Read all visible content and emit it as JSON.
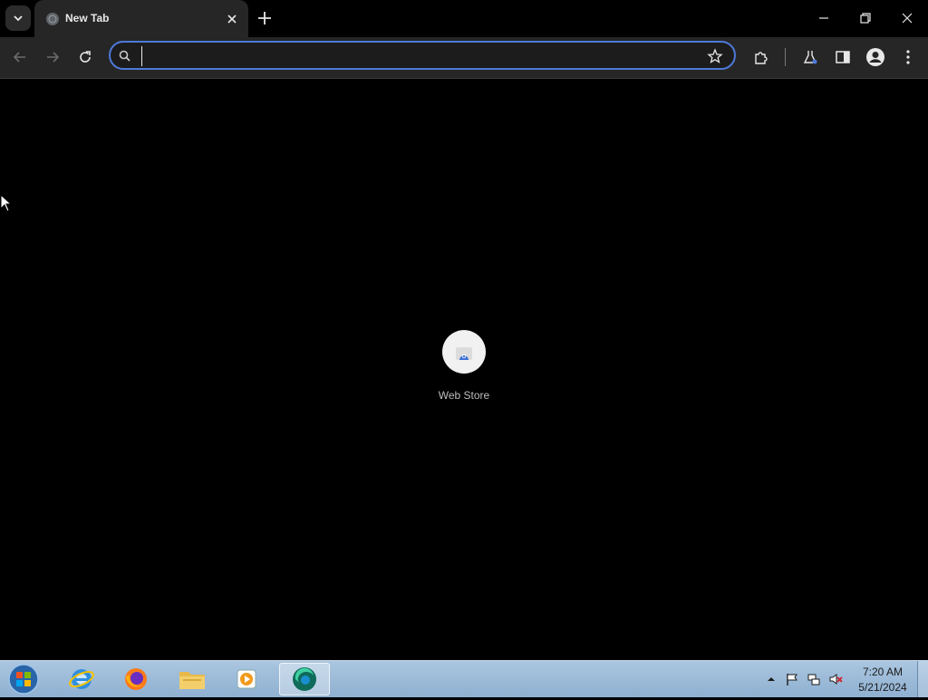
{
  "tab": {
    "title": "New Tab"
  },
  "omnibox": {
    "value": "",
    "placeholder": ""
  },
  "shortcuts": [
    {
      "label": "Web Store"
    }
  ],
  "taskbar": {
    "apps": [
      "start-orb",
      "internet-explorer",
      "firefox",
      "file-explorer",
      "media-player",
      "browser-active"
    ],
    "time": "7:20 AM",
    "date": "5/21/2024"
  },
  "colors": {
    "accent": "#4d79d8",
    "toolbar": "#262626",
    "page_bg": "#000000"
  }
}
